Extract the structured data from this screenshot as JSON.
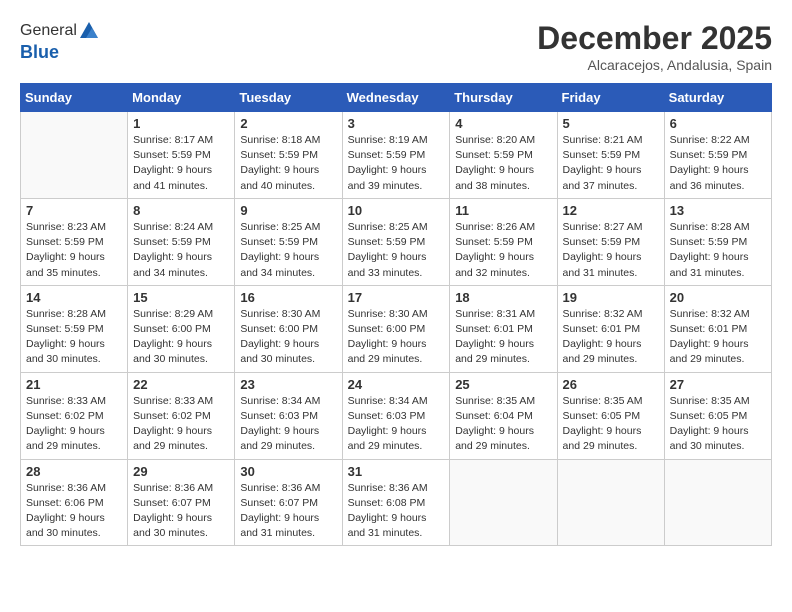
{
  "logo": {
    "general": "General",
    "blue": "Blue"
  },
  "title": "December 2025",
  "location": "Alcaracejos, Andalusia, Spain",
  "weekdays": [
    "Sunday",
    "Monday",
    "Tuesday",
    "Wednesday",
    "Thursday",
    "Friday",
    "Saturday"
  ],
  "weeks": [
    [
      {
        "day": "",
        "sunrise": "",
        "sunset": "",
        "daylight": ""
      },
      {
        "day": "1",
        "sunrise": "Sunrise: 8:17 AM",
        "sunset": "Sunset: 5:59 PM",
        "daylight": "Daylight: 9 hours and 41 minutes."
      },
      {
        "day": "2",
        "sunrise": "Sunrise: 8:18 AM",
        "sunset": "Sunset: 5:59 PM",
        "daylight": "Daylight: 9 hours and 40 minutes."
      },
      {
        "day": "3",
        "sunrise": "Sunrise: 8:19 AM",
        "sunset": "Sunset: 5:59 PM",
        "daylight": "Daylight: 9 hours and 39 minutes."
      },
      {
        "day": "4",
        "sunrise": "Sunrise: 8:20 AM",
        "sunset": "Sunset: 5:59 PM",
        "daylight": "Daylight: 9 hours and 38 minutes."
      },
      {
        "day": "5",
        "sunrise": "Sunrise: 8:21 AM",
        "sunset": "Sunset: 5:59 PM",
        "daylight": "Daylight: 9 hours and 37 minutes."
      },
      {
        "day": "6",
        "sunrise": "Sunrise: 8:22 AM",
        "sunset": "Sunset: 5:59 PM",
        "daylight": "Daylight: 9 hours and 36 minutes."
      }
    ],
    [
      {
        "day": "7",
        "sunrise": "Sunrise: 8:23 AM",
        "sunset": "Sunset: 5:59 PM",
        "daylight": "Daylight: 9 hours and 35 minutes."
      },
      {
        "day": "8",
        "sunrise": "Sunrise: 8:24 AM",
        "sunset": "Sunset: 5:59 PM",
        "daylight": "Daylight: 9 hours and 34 minutes."
      },
      {
        "day": "9",
        "sunrise": "Sunrise: 8:25 AM",
        "sunset": "Sunset: 5:59 PM",
        "daylight": "Daylight: 9 hours and 34 minutes."
      },
      {
        "day": "10",
        "sunrise": "Sunrise: 8:25 AM",
        "sunset": "Sunset: 5:59 PM",
        "daylight": "Daylight: 9 hours and 33 minutes."
      },
      {
        "day": "11",
        "sunrise": "Sunrise: 8:26 AM",
        "sunset": "Sunset: 5:59 PM",
        "daylight": "Daylight: 9 hours and 32 minutes."
      },
      {
        "day": "12",
        "sunrise": "Sunrise: 8:27 AM",
        "sunset": "Sunset: 5:59 PM",
        "daylight": "Daylight: 9 hours and 31 minutes."
      },
      {
        "day": "13",
        "sunrise": "Sunrise: 8:28 AM",
        "sunset": "Sunset: 5:59 PM",
        "daylight": "Daylight: 9 hours and 31 minutes."
      }
    ],
    [
      {
        "day": "14",
        "sunrise": "Sunrise: 8:28 AM",
        "sunset": "Sunset: 5:59 PM",
        "daylight": "Daylight: 9 hours and 30 minutes."
      },
      {
        "day": "15",
        "sunrise": "Sunrise: 8:29 AM",
        "sunset": "Sunset: 6:00 PM",
        "daylight": "Daylight: 9 hours and 30 minutes."
      },
      {
        "day": "16",
        "sunrise": "Sunrise: 8:30 AM",
        "sunset": "Sunset: 6:00 PM",
        "daylight": "Daylight: 9 hours and 30 minutes."
      },
      {
        "day": "17",
        "sunrise": "Sunrise: 8:30 AM",
        "sunset": "Sunset: 6:00 PM",
        "daylight": "Daylight: 9 hours and 29 minutes."
      },
      {
        "day": "18",
        "sunrise": "Sunrise: 8:31 AM",
        "sunset": "Sunset: 6:01 PM",
        "daylight": "Daylight: 9 hours and 29 minutes."
      },
      {
        "day": "19",
        "sunrise": "Sunrise: 8:32 AM",
        "sunset": "Sunset: 6:01 PM",
        "daylight": "Daylight: 9 hours and 29 minutes."
      },
      {
        "day": "20",
        "sunrise": "Sunrise: 8:32 AM",
        "sunset": "Sunset: 6:01 PM",
        "daylight": "Daylight: 9 hours and 29 minutes."
      }
    ],
    [
      {
        "day": "21",
        "sunrise": "Sunrise: 8:33 AM",
        "sunset": "Sunset: 6:02 PM",
        "daylight": "Daylight: 9 hours and 29 minutes."
      },
      {
        "day": "22",
        "sunrise": "Sunrise: 8:33 AM",
        "sunset": "Sunset: 6:02 PM",
        "daylight": "Daylight: 9 hours and 29 minutes."
      },
      {
        "day": "23",
        "sunrise": "Sunrise: 8:34 AM",
        "sunset": "Sunset: 6:03 PM",
        "daylight": "Daylight: 9 hours and 29 minutes."
      },
      {
        "day": "24",
        "sunrise": "Sunrise: 8:34 AM",
        "sunset": "Sunset: 6:03 PM",
        "daylight": "Daylight: 9 hours and 29 minutes."
      },
      {
        "day": "25",
        "sunrise": "Sunrise: 8:35 AM",
        "sunset": "Sunset: 6:04 PM",
        "daylight": "Daylight: 9 hours and 29 minutes."
      },
      {
        "day": "26",
        "sunrise": "Sunrise: 8:35 AM",
        "sunset": "Sunset: 6:05 PM",
        "daylight": "Daylight: 9 hours and 29 minutes."
      },
      {
        "day": "27",
        "sunrise": "Sunrise: 8:35 AM",
        "sunset": "Sunset: 6:05 PM",
        "daylight": "Daylight: 9 hours and 30 minutes."
      }
    ],
    [
      {
        "day": "28",
        "sunrise": "Sunrise: 8:36 AM",
        "sunset": "Sunset: 6:06 PM",
        "daylight": "Daylight: 9 hours and 30 minutes."
      },
      {
        "day": "29",
        "sunrise": "Sunrise: 8:36 AM",
        "sunset": "Sunset: 6:07 PM",
        "daylight": "Daylight: 9 hours and 30 minutes."
      },
      {
        "day": "30",
        "sunrise": "Sunrise: 8:36 AM",
        "sunset": "Sunset: 6:07 PM",
        "daylight": "Daylight: 9 hours and 31 minutes."
      },
      {
        "day": "31",
        "sunrise": "Sunrise: 8:36 AM",
        "sunset": "Sunset: 6:08 PM",
        "daylight": "Daylight: 9 hours and 31 minutes."
      },
      {
        "day": "",
        "sunrise": "",
        "sunset": "",
        "daylight": ""
      },
      {
        "day": "",
        "sunrise": "",
        "sunset": "",
        "daylight": ""
      },
      {
        "day": "",
        "sunrise": "",
        "sunset": "",
        "daylight": ""
      }
    ]
  ]
}
